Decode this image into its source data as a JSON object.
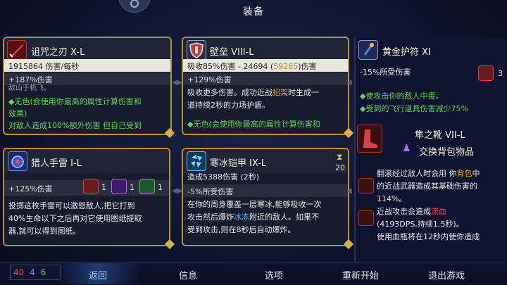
{
  "title": "装备",
  "cards": {
    "curse_blade": {
      "name": "诅咒之刃 X-L",
      "stat1": "1915864 伤害/每秒",
      "stat2": "+187%伤害",
      "partial": "敌山于机飞。",
      "line1": "◆无色(会使用你最高的属性计算伤害和",
      "line2": "效果)",
      "line3": "对敌人造成100%额外伤害 但自己受到"
    },
    "rampart": {
      "name": "壁垒 VIII-L",
      "stat1_a": "吸收85%伤害 - 24694 (",
      "stat1_b": "59265",
      "stat1_c": ")伤害",
      "stat2": "+129%伤害",
      "line1": "吸收更多伤害。成功近战",
      "line1_hl": "招架",
      "line1_b": "时生成一",
      "line2": "道持续2秒的力场护盾。",
      "line3": "◆无色(会使用你最高的属性计算伤害和"
    },
    "hunter_grenade": {
      "name": "猎人手雷 I-L",
      "stat2": "+125%伤害",
      "scroll1": "1",
      "scroll2": "1",
      "scroll3": "1",
      "line1": "投掷这枚手雷可以激怒敌人,把它打到",
      "line2": "40%生命以下之后再对它使用图纸提取",
      "line3": "器,就可以得到图纸。"
    },
    "frost_armor": {
      "name": "寒冰铠甲 IX-L",
      "count": "20",
      "stat1": "造成5388伤害 (2秒)",
      "stat2": "-5%所受伤害",
      "line1": "在你的周身覆盖一层寒冰,能够吸收一次",
      "line2a": "攻击然后爆炸",
      "line2_hl": "冰冻",
      "line2b": "附近的敌人。如果不",
      "line3": "受到攻击,则在8秒后自动爆炸。"
    }
  },
  "right_panel": {
    "amulet_name": "黄金护符 XI",
    "amulet_stat": "-15%所受伤害",
    "amulet_count": "3",
    "amulet_line1": "◆使攻击你的敌人中毒。",
    "amulet_line2": "◆受到的飞行道具伤害减少75%",
    "boots_name": "隼之靴 VII-L",
    "swap_label": "交换背包物品",
    "boots_line1a": "翻滚经过敌人时会用 你",
    "boots_line1_hl": "背包",
    "boots_line1b": "中",
    "boots_line2": "的近战武器造成其基础伤害的",
    "boots_line3": "114%。",
    "boots_line4a": "近战攻击会造成",
    "boots_line4_hl": "流血",
    "boots_line5": "(4193DPS,持续1.5秒)。",
    "boots_line6": "使用血瓶将在12秒内使你造成"
  },
  "stats": {
    "brutality": "40",
    "tactics": "4",
    "survival": "6"
  },
  "menu": {
    "back": "返回",
    "info": "信息",
    "options": "选项",
    "restart": "重新开始",
    "quit": "退出游戏"
  },
  "colors": {
    "brutality": "#ff3b3b",
    "tactics": "#b46cff",
    "survival": "#3ddc5c",
    "gold_border": "#b9902f"
  }
}
